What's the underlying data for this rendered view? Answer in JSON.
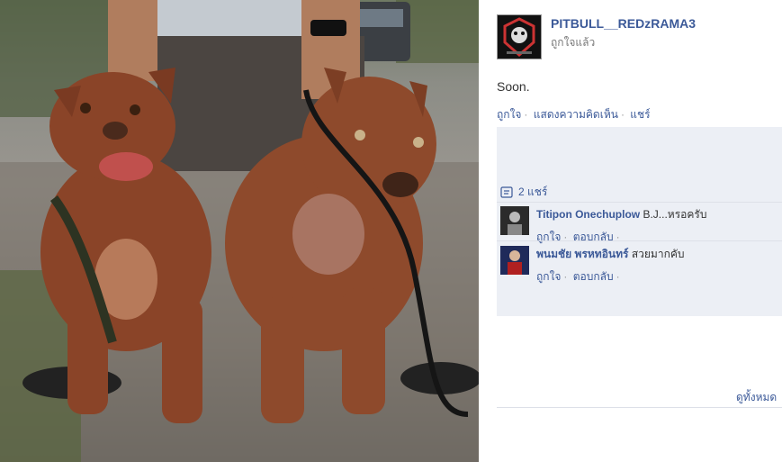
{
  "page": {
    "name": "PITBULL__REDzRAMA3",
    "liked_status": "ถูกใจแล้ว",
    "post_text": "Soon."
  },
  "post_actions": {
    "like": "ถูกใจ",
    "comment": "แสดงความคิดเห็น",
    "share": "แชร์"
  },
  "shares": {
    "label": "2 แชร์"
  },
  "comments": [
    {
      "name": "Titipon Onechuplow",
      "text": "B.J...หรอครับ",
      "like": "ถูกใจ",
      "reply": "ตอบกลับ"
    },
    {
      "name": "พนมชัย พรหทอินทร์",
      "text": "สวยมากคับ",
      "like": "ถูกใจ",
      "reply": "ตอบกลับ"
    }
  ],
  "see_all": "ดูทั้งหมด",
  "colors": {
    "link": "#3b5998",
    "panel": "#eceff5"
  }
}
